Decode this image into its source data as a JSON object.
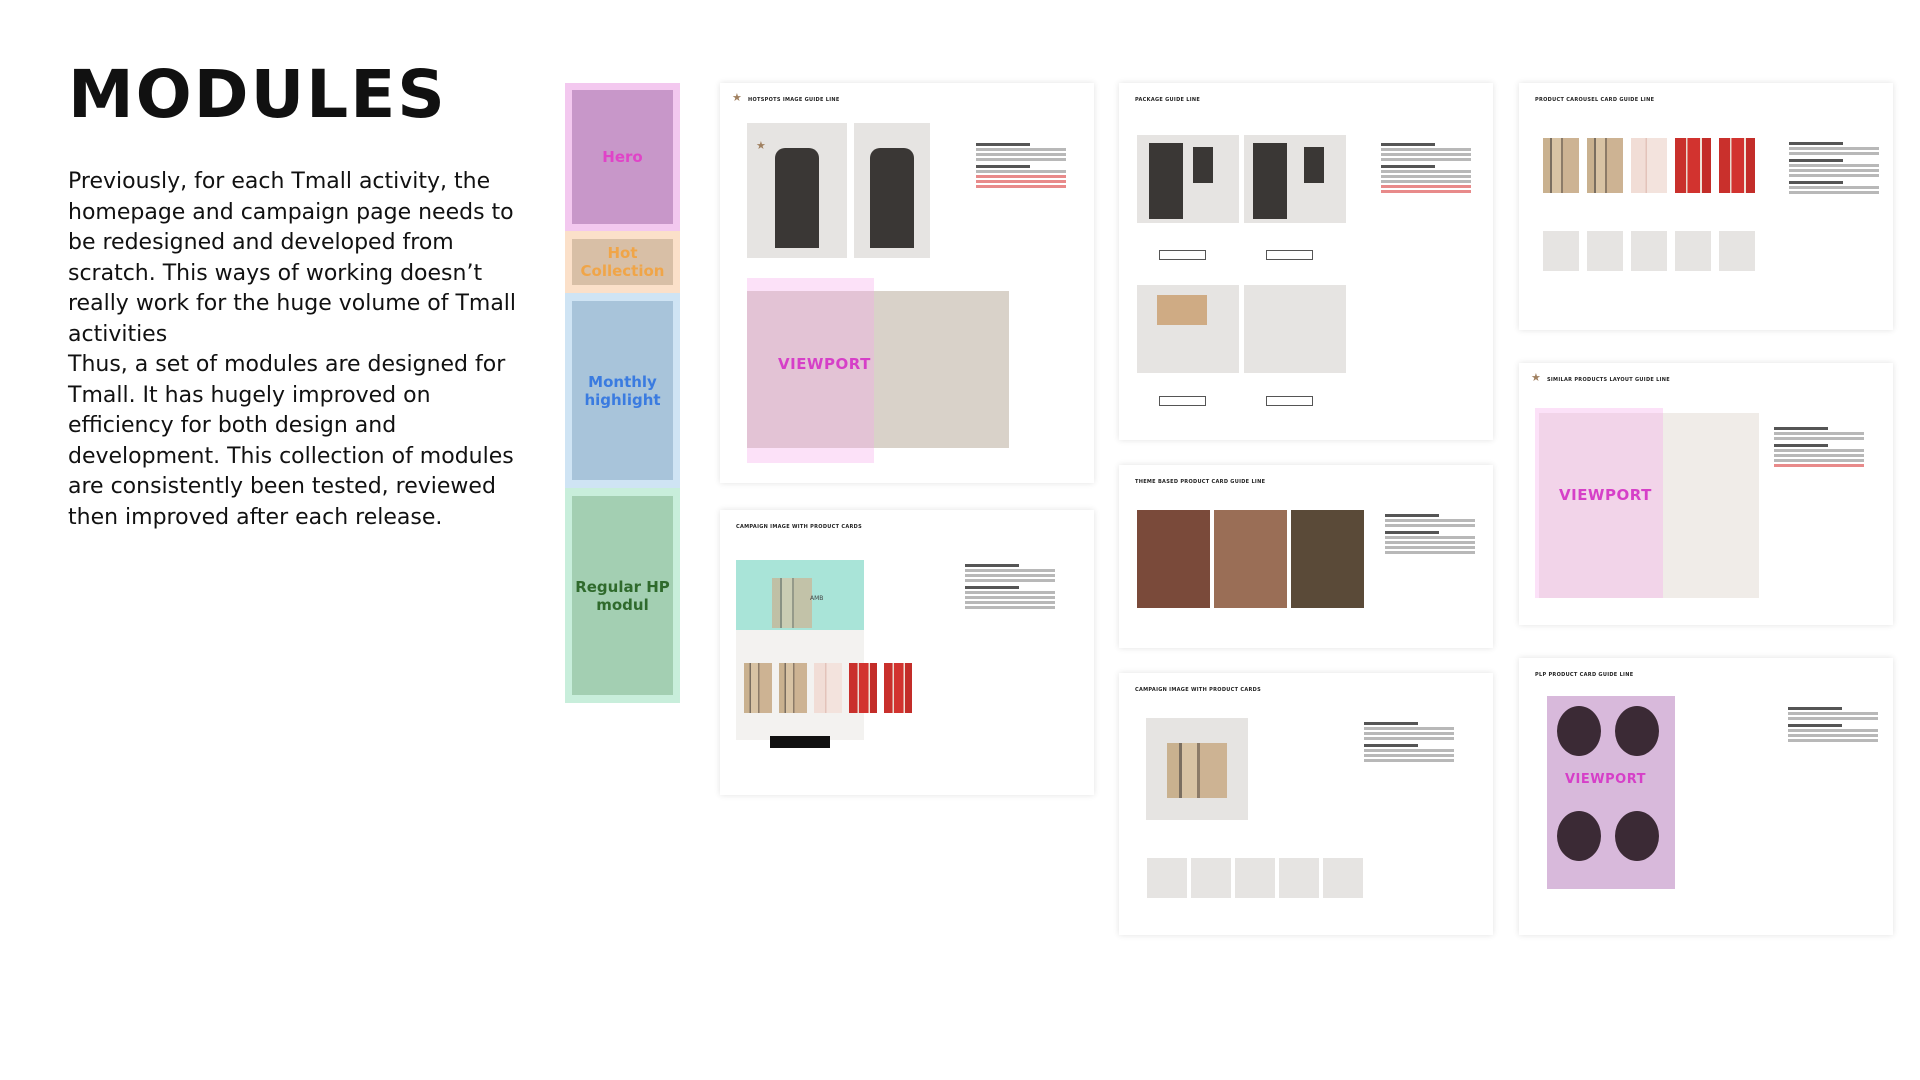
{
  "page": {
    "title": "MODULES",
    "paragraphs": [
      "Previously, for each Tmall activity, the homepage and campaign page needs to be redesigned and developed from scratch. This ways of working doesn’t really work for the huge volume of Tmall activities",
      "Thus, a set of modules are designed for Tmall. It has hugely improved on efficiency for both design and development. This collection of modules are consistently been tested, reviewed then improved after each release."
    ]
  },
  "module_strip": {
    "sections": [
      {
        "label": "Hero",
        "color": "#e043c8"
      },
      {
        "label": "Hot Collection",
        "color": "#f0a548"
      },
      {
        "label": "Monthly highlight",
        "color": "#3a7be0"
      },
      {
        "label": "Regular HP modul",
        "color": "#2f6a2c"
      }
    ]
  },
  "viewport_label": "VIEWPORT",
  "cards": {
    "hotspots": {
      "title": "HOTSPOTS IMAGE GUIDE LINE"
    },
    "campaign_a": {
      "title": "CAMPAIGN IMAGE WITH PRODUCT CARDS",
      "brand": "AMB"
    },
    "package": {
      "title": "PACKAGE GUIDE LINE"
    },
    "theme": {
      "title": "THEME BASED PRODUCT CARD GUIDE LINE"
    },
    "campaign_b": {
      "title": "CAMPAIGN IMAGE WITH PRODUCT CARDS"
    },
    "carousel": {
      "title": "PRODUCT CAROUSEL CARD GUIDE LINE"
    },
    "similar": {
      "title": "SIMILAR PRODUCTS LAYOUT GUIDE LINE"
    },
    "plp": {
      "title": "PLP PRODUCT CARD GUIDE LINE"
    }
  }
}
